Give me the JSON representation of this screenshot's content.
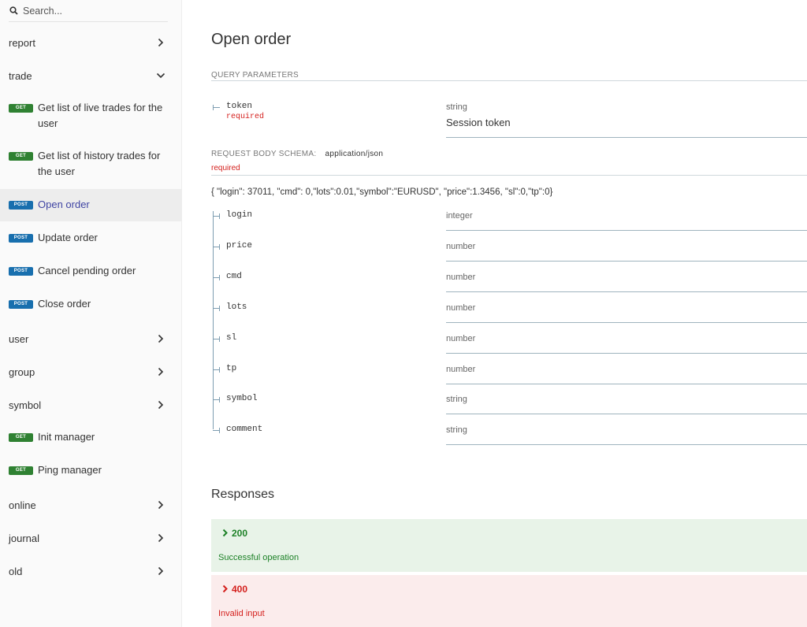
{
  "search": {
    "placeholder": "Search..."
  },
  "sidebar": {
    "groups": {
      "report": "report",
      "trade": "trade",
      "user": "user",
      "group": "group",
      "symbol": "symbol",
      "online": "online",
      "journal": "journal",
      "old": "old"
    },
    "ops": {
      "live_trades": {
        "method": "GET",
        "label": "Get list of live trades for the user"
      },
      "history_trades": {
        "method": "GET",
        "label": "Get list of history trades for the user"
      },
      "open_order": {
        "method": "POST",
        "label": "Open order"
      },
      "update_order": {
        "method": "POST",
        "label": "Update order"
      },
      "cancel_pending": {
        "method": "POST",
        "label": "Cancel pending order"
      },
      "close_order": {
        "method": "POST",
        "label": "Close order"
      },
      "init_manager": {
        "method": "GET",
        "label": "Init manager"
      },
      "ping_manager": {
        "method": "GET",
        "label": "Ping manager"
      }
    }
  },
  "main": {
    "title": "Open order",
    "query_params_heading": "QUERY PARAMETERS",
    "query_param": {
      "name": "token",
      "required": "required",
      "type": "string",
      "description": "Session token"
    },
    "body_heading": "REQUEST BODY SCHEMA:",
    "body_content_type": "application/json",
    "body_required": "required",
    "example": "{ \"login\": 37011, \"cmd\": 0,\"lots\":0.01,\"symbol\":\"EURUSD\", \"price\":1.3456, \"sl\":0,\"tp\":0}",
    "fields": [
      {
        "name": "login",
        "type": "integer"
      },
      {
        "name": "price",
        "type": "number"
      },
      {
        "name": "cmd",
        "type": "number"
      },
      {
        "name": "lots",
        "type": "number"
      },
      {
        "name": "sl",
        "type": "number"
      },
      {
        "name": "tp",
        "type": "number"
      },
      {
        "name": "symbol",
        "type": "string"
      },
      {
        "name": "comment",
        "type": "string"
      }
    ],
    "responses_heading": "Responses",
    "responses": [
      {
        "code": "200",
        "description": "Successful operation",
        "color": "#1d8127"
      },
      {
        "code": "400",
        "description": "Invalid input",
        "color": "#d41f1c"
      }
    ]
  },
  "colors": {
    "get": "#2f8132",
    "post": "#186fae",
    "active_link": "#3f44a3",
    "required": "#d41f1c"
  }
}
